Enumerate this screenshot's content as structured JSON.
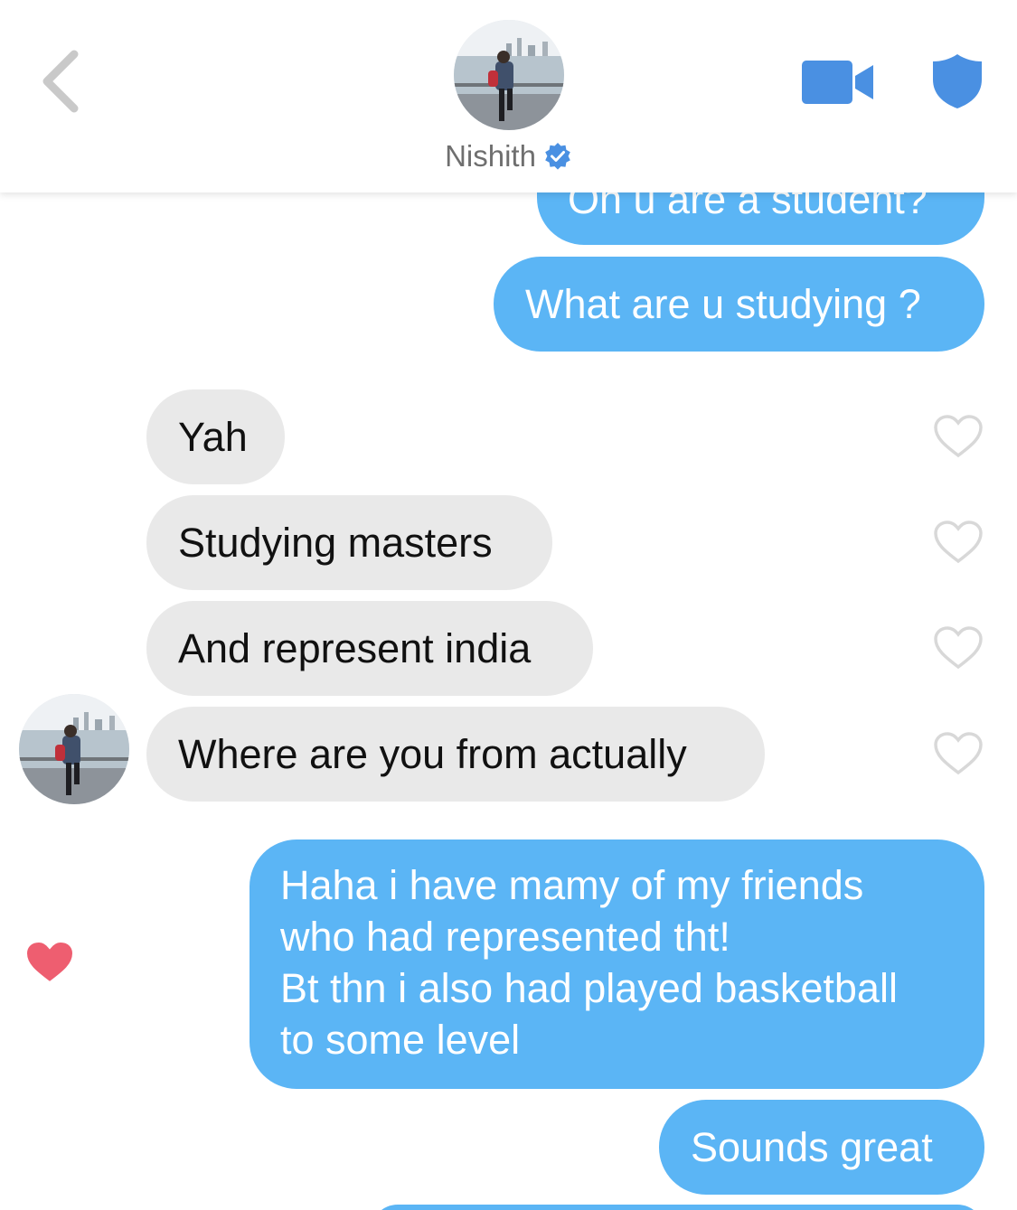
{
  "header": {
    "contact_name": "Nishith",
    "back_icon": "chevron-left-icon",
    "video_icon": "video-camera-icon",
    "safety_icon": "shield-icon",
    "verified_icon": "verified-badge-icon",
    "accent_color": "#4a90e2"
  },
  "colors": {
    "sent_bubble": "#5bb5f5",
    "received_bubble": "#e9e9e9",
    "liked_heart": "#ee5e70",
    "unliked_heart": "#d8d8d8"
  },
  "messages": [
    {
      "direction": "sent",
      "lines": [
        "Oh u are a student?"
      ]
    },
    {
      "direction": "sent",
      "lines": [
        "What are u studying ?"
      ]
    },
    {
      "direction": "received",
      "lines": [
        "Yah"
      ],
      "liked": false
    },
    {
      "direction": "received",
      "lines": [
        "Studying masters"
      ],
      "liked": false
    },
    {
      "direction": "received",
      "lines": [
        "And represent india"
      ],
      "liked": false
    },
    {
      "direction": "received",
      "lines": [
        "Where are you from actually"
      ],
      "liked": false
    },
    {
      "direction": "sent",
      "lines": [
        "Haha i have mamy of my friends",
        "who had represented tht!",
        "Bt thn i also had played basketball",
        "to some level"
      ],
      "liked": true
    },
    {
      "direction": "sent",
      "lines": [
        "Sounds great"
      ]
    }
  ]
}
